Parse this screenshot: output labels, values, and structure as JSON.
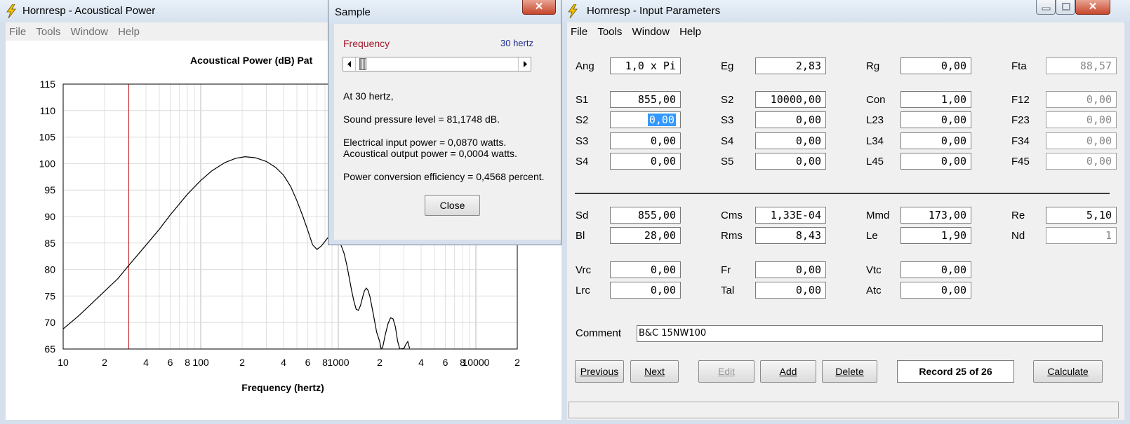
{
  "acoustical_window": {
    "title": "Hornresp - Acoustical Power",
    "menu": [
      "File",
      "Tools",
      "Window",
      "Help"
    ]
  },
  "chart_data": {
    "type": "line",
    "title": "Acoustical Power (dB)   Pat",
    "xlabel": "Frequency (hertz)",
    "ylabel": "",
    "x_scale": "log",
    "xlim": [
      10,
      20000
    ],
    "ylim": [
      65,
      115
    ],
    "y_ticks": [
      65,
      70,
      75,
      80,
      85,
      90,
      95,
      100,
      105,
      110,
      115
    ],
    "x_tick_values": [
      10,
      20,
      40,
      60,
      80,
      100,
      200,
      400,
      600,
      800,
      1000,
      2000,
      4000,
      6000,
      8000,
      10000,
      20000
    ],
    "x_tick_labels": [
      "10",
      "2",
      "4",
      "6",
      "8",
      "100",
      "2",
      "4",
      "6",
      "8",
      "1000",
      "2",
      "4",
      "6",
      "8",
      "10000",
      "2"
    ],
    "grid": true,
    "marker_x": 30,
    "series": [
      {
        "x": [
          10,
          13,
          16,
          20,
          25,
          30,
          40,
          50,
          60,
          80,
          100,
          120,
          150,
          180,
          210,
          250,
          300,
          350,
          400,
          450,
          500,
          550,
          600,
          650,
          700,
          750,
          800,
          850,
          900,
          950,
          1000,
          1050,
          1100,
          1150,
          1200,
          1250,
          1300,
          1350,
          1400,
          1450,
          1500,
          1550,
          1600,
          1650,
          1700,
          1800,
          1900,
          2000,
          2050,
          2100,
          2200,
          2300,
          2400,
          2500,
          2600,
          2700,
          2800,
          3000,
          3100,
          3200,
          3300
        ],
        "y": [
          68.8,
          71.3,
          73.5,
          75.9,
          78.3,
          80.8,
          84.6,
          87.6,
          90.3,
          94.2,
          96.8,
          98.6,
          100.2,
          101.0,
          101.3,
          101.1,
          100.4,
          99.3,
          97.8,
          95.7,
          93.0,
          90.2,
          87.4,
          84.7,
          83.8,
          84.4,
          85.3,
          86.2,
          86.5,
          86.0,
          85.4,
          84.5,
          83.1,
          81.0,
          78.5,
          76.0,
          74.0,
          72.5,
          72.3,
          73.2,
          74.7,
          76.0,
          76.5,
          76.0,
          74.8,
          71.5,
          68.2,
          66.4,
          64.8,
          65.3,
          67.8,
          69.8,
          70.9,
          70.7,
          69.2,
          66.5,
          65.0,
          65.1,
          65.9,
          66.4,
          65.1
        ]
      }
    ]
  },
  "input_window": {
    "title": "Hornresp - Input Parameters",
    "menu": [
      "File",
      "Tools",
      "Window",
      "Help"
    ],
    "rows": [
      {
        "cells": [
          {
            "label": "Ang",
            "value": "1,0 x Pi",
            "ro": false
          },
          {
            "label": "Eg",
            "value": "2,83",
            "ro": false
          },
          {
            "label": "Rg",
            "value": "0,00",
            "ro": false
          },
          {
            "label": "Fta",
            "value": "88,57",
            "ro": true
          }
        ]
      },
      {
        "cells": [
          {
            "label": "S1",
            "value": "855,00",
            "ro": false
          },
          {
            "label": "S2",
            "value": "10000,00",
            "ro": false
          },
          {
            "label": "Con",
            "value": "1,00",
            "ro": false
          },
          {
            "label": "F12",
            "value": "0,00",
            "ro": true
          }
        ]
      },
      {
        "cells": [
          {
            "label": "S2",
            "value": "0,00",
            "ro": false,
            "sel": true
          },
          {
            "label": "S3",
            "value": "0,00",
            "ro": false
          },
          {
            "label": "L23",
            "value": "0,00",
            "ro": false
          },
          {
            "label": "F23",
            "value": "0,00",
            "ro": true
          }
        ]
      },
      {
        "cells": [
          {
            "label": "S3",
            "value": "0,00",
            "ro": false
          },
          {
            "label": "S4",
            "value": "0,00",
            "ro": false
          },
          {
            "label": "L34",
            "value": "0,00",
            "ro": false
          },
          {
            "label": "F34",
            "value": "0,00",
            "ro": true
          }
        ]
      },
      {
        "cells": [
          {
            "label": "S4",
            "value": "0,00",
            "ro": false
          },
          {
            "label": "S5",
            "value": "0,00",
            "ro": false
          },
          {
            "label": "L45",
            "value": "0,00",
            "ro": false
          },
          {
            "label": "F45",
            "value": "0,00",
            "ro": true
          }
        ]
      },
      {
        "cells": [
          {
            "label": "Sd",
            "value": "855,00",
            "ro": false
          },
          {
            "label": "Cms",
            "value": "1,33E-04",
            "ro": false
          },
          {
            "label": "Mmd",
            "value": "173,00",
            "ro": false
          },
          {
            "label": "Re",
            "value": "5,10",
            "ro": false
          }
        ]
      },
      {
        "cells": [
          {
            "label": "Bl",
            "value": "28,00",
            "ro": false
          },
          {
            "label": "Rms",
            "value": "8,43",
            "ro": false
          },
          {
            "label": "Le",
            "value": "1,90",
            "ro": false
          },
          {
            "label": "Nd",
            "value": "1",
            "ro": true
          }
        ]
      },
      {
        "cells": [
          {
            "label": "Vrc",
            "value": "0,00",
            "ro": false
          },
          {
            "label": "Fr",
            "value": "0,00",
            "ro": false
          },
          {
            "label": "Vtc",
            "value": "0,00",
            "ro": false
          }
        ]
      },
      {
        "cells": [
          {
            "label": "Lrc",
            "value": "0,00",
            "ro": false
          },
          {
            "label": "Tal",
            "value": "0,00",
            "ro": false
          },
          {
            "label": "Atc",
            "value": "0,00",
            "ro": false
          }
        ]
      }
    ],
    "comment_label": "Comment",
    "comment_value": "B&C 15NW100",
    "buttons": {
      "previous": "Previous",
      "next": "Next",
      "edit": "Edit",
      "add": "Add",
      "delete": "Delete",
      "calculate": "Calculate"
    },
    "record_label": "Record 25 of 26"
  },
  "sample_dialog": {
    "title": "Sample",
    "frequency_label": "Frequency",
    "frequency_value": "30 hertz",
    "slider_fraction": 0.02,
    "line_at": "At 30 hertz,",
    "line_spl": "Sound pressure level = 81,1748 dB.",
    "line_elec": "Electrical input power = 0,0870 watts.",
    "line_acou": "Acoustical output power = 0,0004 watts.",
    "line_eff": "Power conversion efficiency = 0,4568 percent.",
    "close_label": "Close"
  },
  "colors": {
    "frequency_label": "#a0182a",
    "frequency_value": "#1a2a8c",
    "marker_line": "#c01010",
    "selection": "#3399ff"
  }
}
